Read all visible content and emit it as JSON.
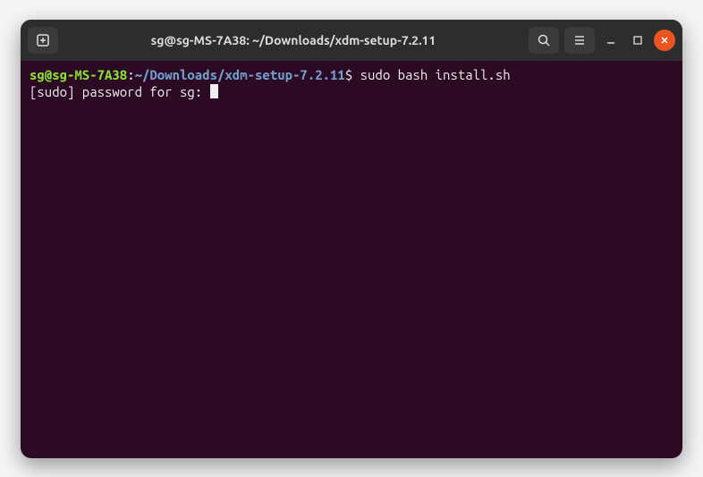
{
  "titlebar": {
    "title": "sg@sg-MS-7A38: ~/Downloads/xdm-setup-7.2.11"
  },
  "terminal": {
    "prompt_user_host": "sg@sg-MS-7A38",
    "prompt_colon": ":",
    "prompt_path": "~/Downloads/xdm-setup-7.2.11",
    "prompt_symbol": "$",
    "command": "sudo bash install.sh",
    "output_prefix": "[sudo] password for sg: "
  }
}
